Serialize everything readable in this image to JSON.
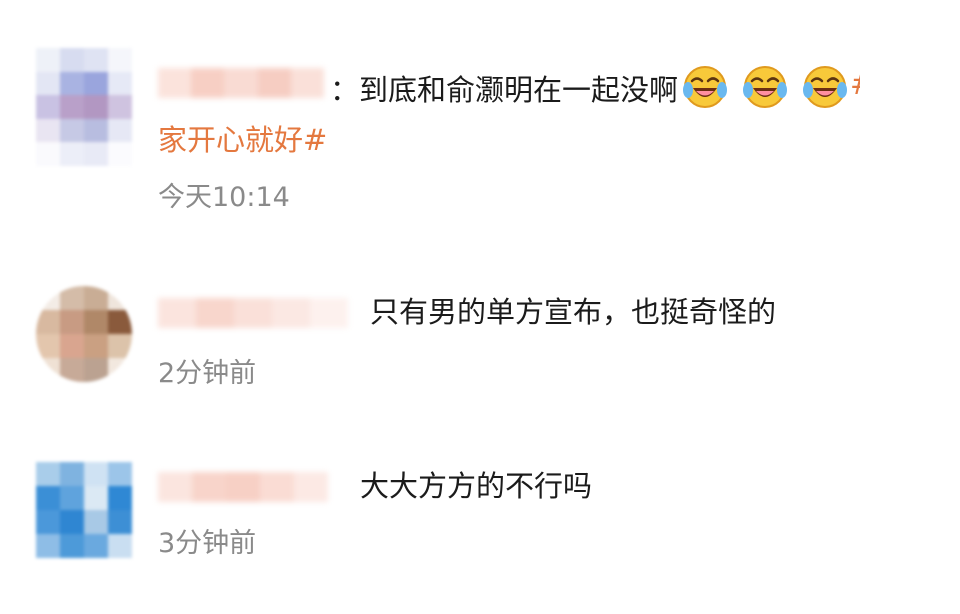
{
  "comments": [
    {
      "separator": "：",
      "text": "到底和俞灏明在一起没啊",
      "emoji_name": "laugh-cry-emoji",
      "emoji_count": 3,
      "topic_start": "#",
      "topic_continued": "家开心就好#",
      "time": "今天10:14"
    },
    {
      "text": "只有男的单方宣布，也挺奇怪的",
      "time": "2分钟前"
    },
    {
      "text": "大大方方的不行吗",
      "time": "3分钟前"
    }
  ],
  "colors": {
    "topic": "#e4783f",
    "time": "#8a8a8a",
    "text": "#1b1b1b"
  }
}
